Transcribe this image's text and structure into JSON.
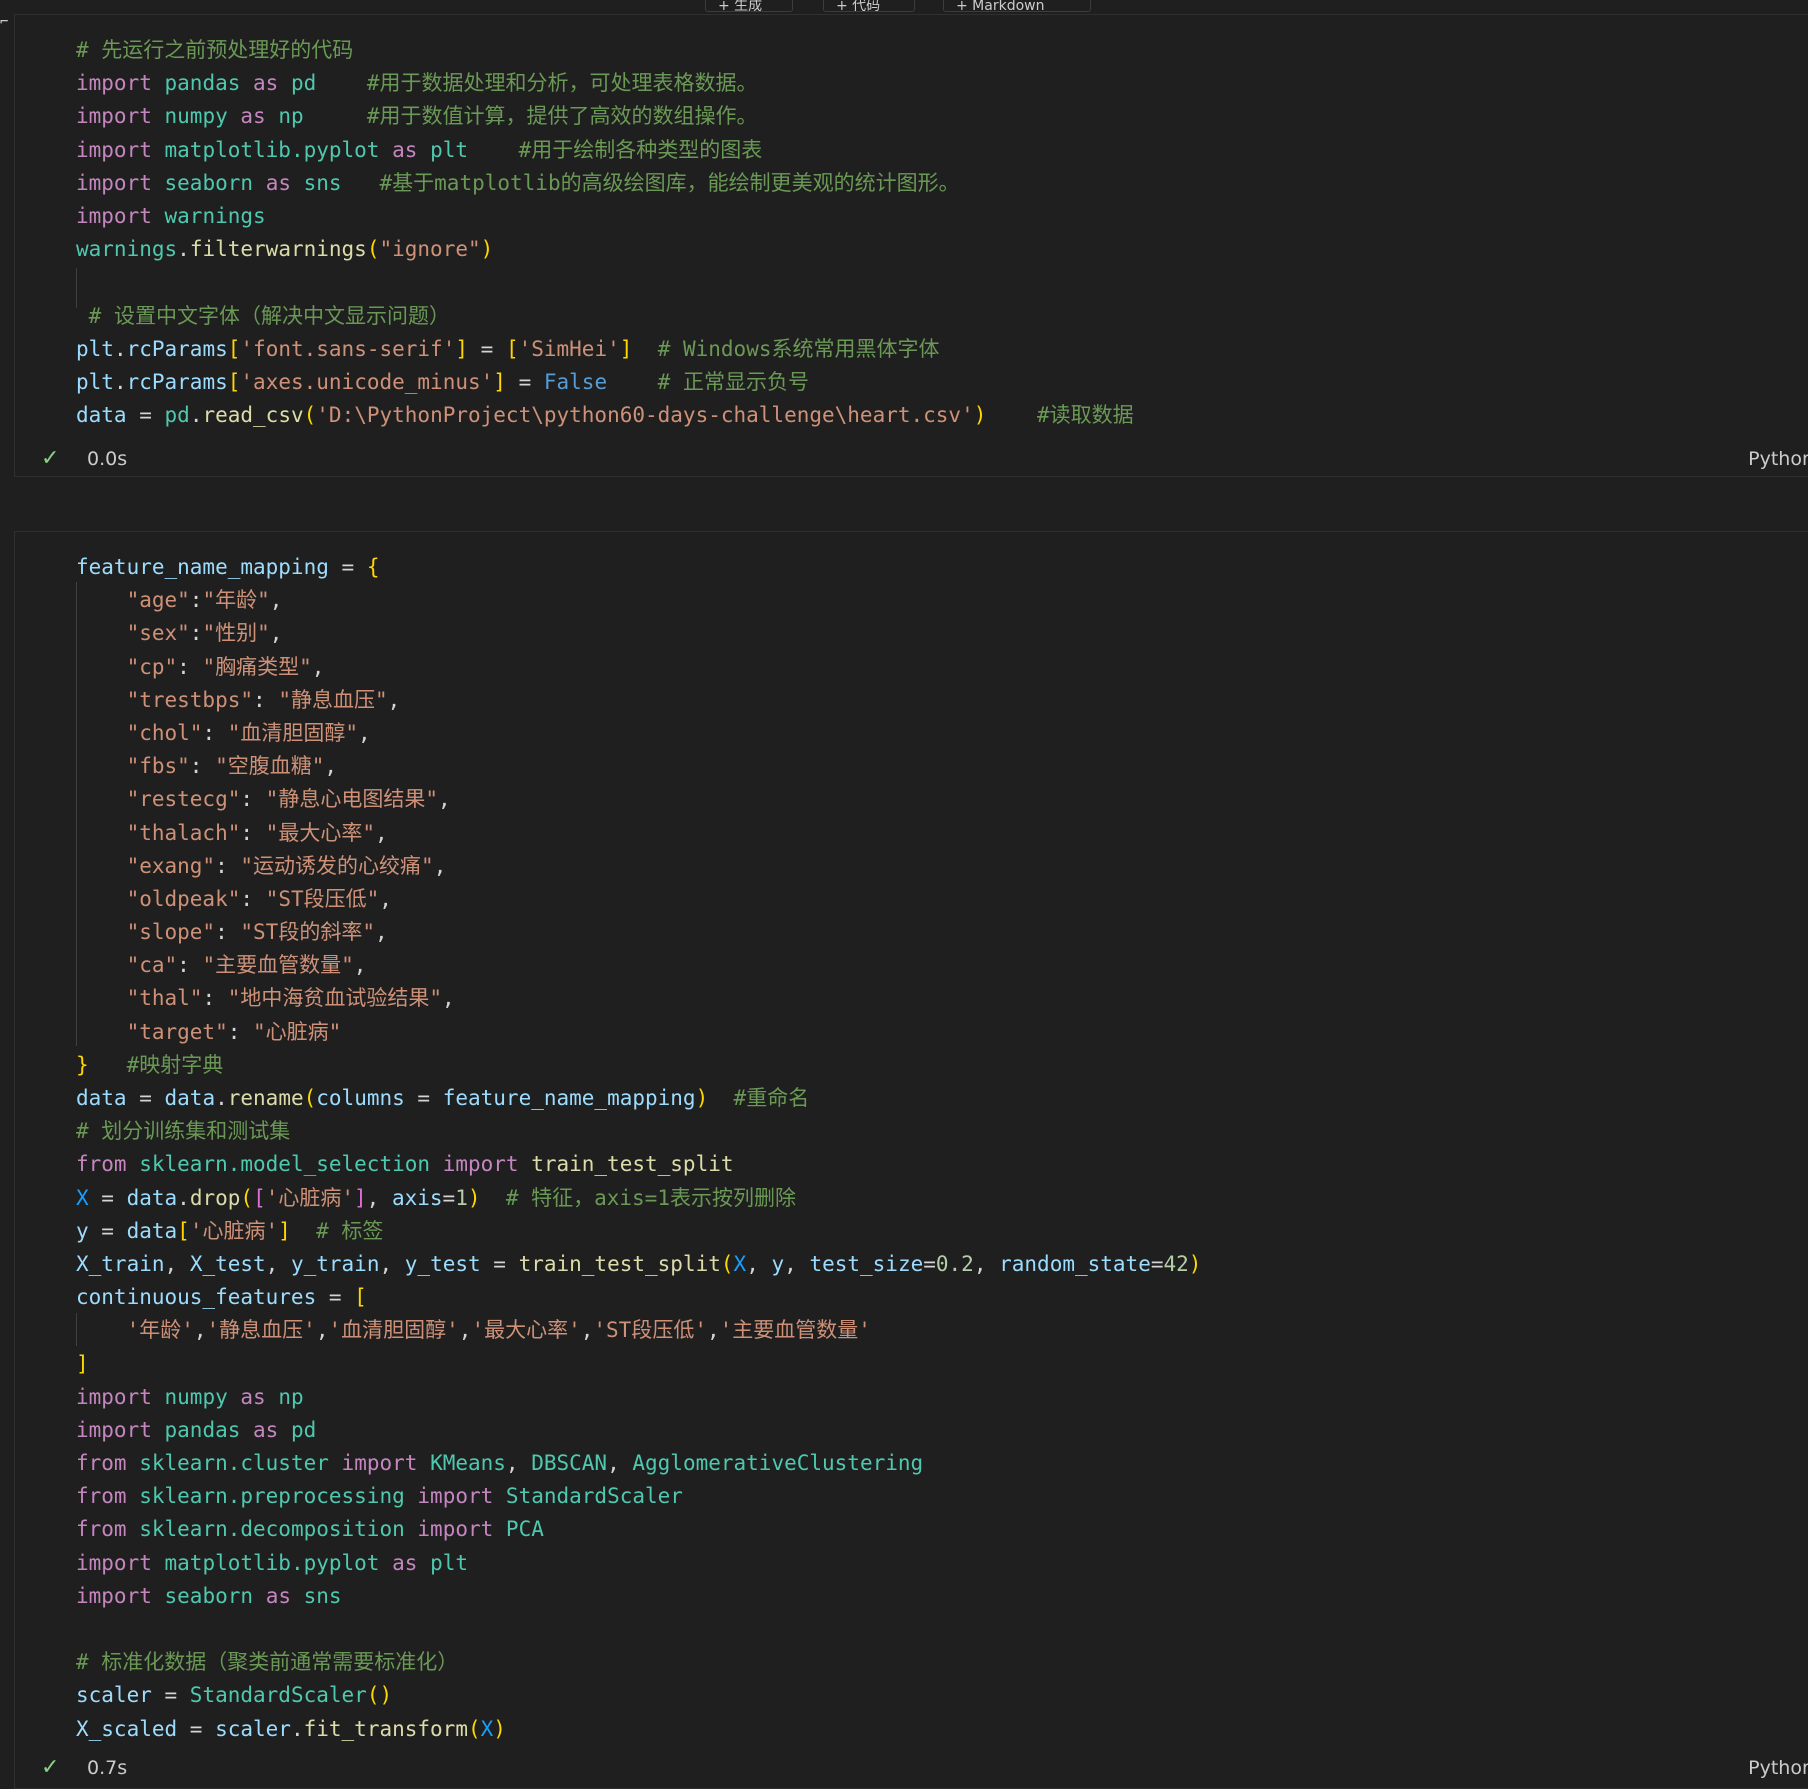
{
  "toolbar": {
    "items": [
      "+ 生成",
      "+ 代码",
      "+ Markdown"
    ]
  },
  "cell1": {
    "lines": [
      [
        [
          "c",
          "# 先运行之前预处理好的代码"
        ]
      ],
      [
        [
          "k",
          "import"
        ],
        [
          "o",
          " "
        ],
        [
          "m",
          "pandas"
        ],
        [
          "o",
          " "
        ],
        [
          "k",
          "as"
        ],
        [
          "o",
          " "
        ],
        [
          "m",
          "pd"
        ],
        [
          "o",
          "    "
        ],
        [
          "c",
          "#用于数据处理和分析，可处理表格数据。"
        ]
      ],
      [
        [
          "k",
          "import"
        ],
        [
          "o",
          " "
        ],
        [
          "m",
          "numpy"
        ],
        [
          "o",
          " "
        ],
        [
          "k",
          "as"
        ],
        [
          "o",
          " "
        ],
        [
          "m",
          "np"
        ],
        [
          "o",
          "     "
        ],
        [
          "c",
          "#用于数值计算，提供了高效的数组操作。"
        ]
      ],
      [
        [
          "k",
          "import"
        ],
        [
          "o",
          " "
        ],
        [
          "m",
          "matplotlib.pyplot"
        ],
        [
          "o",
          " "
        ],
        [
          "k",
          "as"
        ],
        [
          "o",
          " "
        ],
        [
          "m",
          "plt"
        ],
        [
          "o",
          "    "
        ],
        [
          "c",
          "#用于绘制各种类型的图表"
        ]
      ],
      [
        [
          "k",
          "import"
        ],
        [
          "o",
          " "
        ],
        [
          "m",
          "seaborn"
        ],
        [
          "o",
          " "
        ],
        [
          "k",
          "as"
        ],
        [
          "o",
          " "
        ],
        [
          "m",
          "sns"
        ],
        [
          "o",
          "   "
        ],
        [
          "c",
          "#基于matplotlib的高级绘图库，能绘制更美观的统计图形。"
        ]
      ],
      [
        [
          "k",
          "import"
        ],
        [
          "o",
          " "
        ],
        [
          "m",
          "warnings"
        ]
      ],
      [
        [
          "m",
          "warnings"
        ],
        [
          "o",
          "."
        ],
        [
          "f",
          "filterwarnings"
        ],
        [
          "y",
          "("
        ],
        [
          "s",
          "\"ignore\""
        ],
        [
          "y",
          ")"
        ]
      ],
      [
        [
          "o",
          ""
        ]
      ],
      [
        [
          "o",
          " "
        ],
        [
          "c",
          "# 设置中文字体（解决中文显示问题）"
        ]
      ],
      [
        [
          "v",
          "plt"
        ],
        [
          "o",
          "."
        ],
        [
          "v",
          "rcParams"
        ],
        [
          "y",
          "["
        ],
        [
          "s",
          "'font.sans-serif'"
        ],
        [
          "y",
          "]"
        ],
        [
          "o",
          " = "
        ],
        [
          "y",
          "["
        ],
        [
          "s",
          "'SimHei'"
        ],
        [
          "y",
          "]"
        ],
        [
          "o",
          "  "
        ],
        [
          "c",
          "# Windows系统常用黑体字体"
        ]
      ],
      [
        [
          "v",
          "plt"
        ],
        [
          "o",
          "."
        ],
        [
          "v",
          "rcParams"
        ],
        [
          "y",
          "["
        ],
        [
          "s",
          "'axes.unicode_minus'"
        ],
        [
          "y",
          "]"
        ],
        [
          "o",
          " = "
        ],
        [
          "b",
          "False"
        ],
        [
          "o",
          "    "
        ],
        [
          "c",
          "# 正常显示负号"
        ]
      ],
      [
        [
          "v",
          "data"
        ],
        [
          "o",
          " = "
        ],
        [
          "m",
          "pd"
        ],
        [
          "o",
          "."
        ],
        [
          "f",
          "read_csv"
        ],
        [
          "y",
          "("
        ],
        [
          "s",
          "'D:\\PythonProject\\python60-days-challenge\\heart.csv'"
        ],
        [
          "y",
          ")"
        ],
        [
          "o",
          "    "
        ],
        [
          "c",
          "#读取数据"
        ]
      ]
    ],
    "status_time": "0.0s",
    "language": "Python"
  },
  "cell2": {
    "lines": [
      [
        [
          "v",
          "feature_name_mapping"
        ],
        [
          "o",
          " = "
        ],
        [
          "y",
          "{"
        ]
      ],
      [
        [
          "o",
          "    "
        ],
        [
          "s",
          "\"age\""
        ],
        [
          "o",
          ":"
        ],
        [
          "s",
          "\"年龄\""
        ],
        [
          "o",
          ","
        ]
      ],
      [
        [
          "o",
          "    "
        ],
        [
          "s",
          "\"sex\""
        ],
        [
          "o",
          ":"
        ],
        [
          "s",
          "\"性别\""
        ],
        [
          "o",
          ","
        ]
      ],
      [
        [
          "o",
          "    "
        ],
        [
          "s",
          "\"cp\""
        ],
        [
          "o",
          ": "
        ],
        [
          "s",
          "\"胸痛类型\""
        ],
        [
          "o",
          ","
        ]
      ],
      [
        [
          "o",
          "    "
        ],
        [
          "s",
          "\"trestbps\""
        ],
        [
          "o",
          ": "
        ],
        [
          "s",
          "\"静息血压\""
        ],
        [
          "o",
          ","
        ]
      ],
      [
        [
          "o",
          "    "
        ],
        [
          "s",
          "\"chol\""
        ],
        [
          "o",
          ": "
        ],
        [
          "s",
          "\"血清胆固醇\""
        ],
        [
          "o",
          ","
        ]
      ],
      [
        [
          "o",
          "    "
        ],
        [
          "s",
          "\"fbs\""
        ],
        [
          "o",
          ": "
        ],
        [
          "s",
          "\"空腹血糖\""
        ],
        [
          "o",
          ","
        ]
      ],
      [
        [
          "o",
          "    "
        ],
        [
          "s",
          "\"restecg\""
        ],
        [
          "o",
          ": "
        ],
        [
          "s",
          "\"静息心电图结果\""
        ],
        [
          "o",
          ","
        ]
      ],
      [
        [
          "o",
          "    "
        ],
        [
          "s",
          "\"thalach\""
        ],
        [
          "o",
          ": "
        ],
        [
          "s",
          "\"最大心率\""
        ],
        [
          "o",
          ","
        ]
      ],
      [
        [
          "o",
          "    "
        ],
        [
          "s",
          "\"exang\""
        ],
        [
          "o",
          ": "
        ],
        [
          "s",
          "\"运动诱发的心绞痛\""
        ],
        [
          "o",
          ","
        ]
      ],
      [
        [
          "o",
          "    "
        ],
        [
          "s",
          "\"oldpeak\""
        ],
        [
          "o",
          ": "
        ],
        [
          "s",
          "\"ST段压低\""
        ],
        [
          "o",
          ","
        ]
      ],
      [
        [
          "o",
          "    "
        ],
        [
          "s",
          "\"slope\""
        ],
        [
          "o",
          ": "
        ],
        [
          "s",
          "\"ST段的斜率\""
        ],
        [
          "o",
          ","
        ]
      ],
      [
        [
          "o",
          "    "
        ],
        [
          "s",
          "\"ca\""
        ],
        [
          "o",
          ": "
        ],
        [
          "s",
          "\"主要血管数量\""
        ],
        [
          "o",
          ","
        ]
      ],
      [
        [
          "o",
          "    "
        ],
        [
          "s",
          "\"thal\""
        ],
        [
          "o",
          ": "
        ],
        [
          "s",
          "\"地中海贫血试验结果\""
        ],
        [
          "o",
          ","
        ]
      ],
      [
        [
          "o",
          "    "
        ],
        [
          "s",
          "\"target\""
        ],
        [
          "o",
          ": "
        ],
        [
          "s",
          "\"心脏病\""
        ]
      ],
      [
        [
          "y",
          "}"
        ],
        [
          "o",
          "   "
        ],
        [
          "c",
          "#映射字典"
        ]
      ],
      [
        [
          "v",
          "data"
        ],
        [
          "o",
          " = "
        ],
        [
          "v",
          "data"
        ],
        [
          "o",
          "."
        ],
        [
          "f",
          "rename"
        ],
        [
          "y",
          "("
        ],
        [
          "v",
          "columns"
        ],
        [
          "o",
          " = "
        ],
        [
          "v",
          "feature_name_mapping"
        ],
        [
          "y",
          ")"
        ],
        [
          "o",
          "  "
        ],
        [
          "c",
          "#重命名"
        ]
      ],
      [
        [
          "c",
          "# 划分训练集和测试集"
        ]
      ],
      [
        [
          "k",
          "from"
        ],
        [
          "o",
          " "
        ],
        [
          "m",
          "sklearn.model_selection"
        ],
        [
          "o",
          " "
        ],
        [
          "k",
          "import"
        ],
        [
          "o",
          " "
        ],
        [
          "f",
          "train_test_split"
        ]
      ],
      [
        [
          "bl",
          "X"
        ],
        [
          "o",
          " = "
        ],
        [
          "v",
          "data"
        ],
        [
          "o",
          "."
        ],
        [
          "f",
          "drop"
        ],
        [
          "y",
          "("
        ],
        [
          "p",
          "["
        ],
        [
          "s",
          "'心脏病'"
        ],
        [
          "p",
          "]"
        ],
        [
          "o",
          ", "
        ],
        [
          "v",
          "axis"
        ],
        [
          "o",
          "="
        ],
        [
          "n",
          "1"
        ],
        [
          "y",
          ")"
        ],
        [
          "o",
          "  "
        ],
        [
          "c",
          "# 特征，axis=1表示按列删除"
        ]
      ],
      [
        [
          "v",
          "y"
        ],
        [
          "o",
          " = "
        ],
        [
          "v",
          "data"
        ],
        [
          "y",
          "["
        ],
        [
          "s",
          "'心脏病'"
        ],
        [
          "y",
          "]"
        ],
        [
          "o",
          "  "
        ],
        [
          "c",
          "# 标签"
        ]
      ],
      [
        [
          "v",
          "X_train"
        ],
        [
          "o",
          ", "
        ],
        [
          "v",
          "X_test"
        ],
        [
          "o",
          ", "
        ],
        [
          "v",
          "y_train"
        ],
        [
          "o",
          ", "
        ],
        [
          "v",
          "y_test"
        ],
        [
          "o",
          " = "
        ],
        [
          "f",
          "train_test_split"
        ],
        [
          "y",
          "("
        ],
        [
          "bl",
          "X"
        ],
        [
          "o",
          ", "
        ],
        [
          "v",
          "y"
        ],
        [
          "o",
          ", "
        ],
        [
          "v",
          "test_size"
        ],
        [
          "o",
          "="
        ],
        [
          "n",
          "0.2"
        ],
        [
          "o",
          ", "
        ],
        [
          "v",
          "random_state"
        ],
        [
          "o",
          "="
        ],
        [
          "n",
          "42"
        ],
        [
          "y",
          ")"
        ]
      ],
      [
        [
          "v",
          "continuous_features"
        ],
        [
          "o",
          " = "
        ],
        [
          "y",
          "["
        ]
      ],
      [
        [
          "o",
          "    "
        ],
        [
          "s",
          "'年龄'"
        ],
        [
          "o",
          ","
        ],
        [
          "s",
          "'静息血压'"
        ],
        [
          "o",
          ","
        ],
        [
          "s",
          "'血清胆固醇'"
        ],
        [
          "o",
          ","
        ],
        [
          "s",
          "'最大心率'"
        ],
        [
          "o",
          ","
        ],
        [
          "s",
          "'ST段压低'"
        ],
        [
          "o",
          ","
        ],
        [
          "s",
          "'主要血管数量'"
        ]
      ],
      [
        [
          "y",
          "]"
        ]
      ],
      [
        [
          "k",
          "import"
        ],
        [
          "o",
          " "
        ],
        [
          "m",
          "numpy"
        ],
        [
          "o",
          " "
        ],
        [
          "k",
          "as"
        ],
        [
          "o",
          " "
        ],
        [
          "m",
          "np"
        ]
      ],
      [
        [
          "k",
          "import"
        ],
        [
          "o",
          " "
        ],
        [
          "m",
          "pandas"
        ],
        [
          "o",
          " "
        ],
        [
          "k",
          "as"
        ],
        [
          "o",
          " "
        ],
        [
          "m",
          "pd"
        ]
      ],
      [
        [
          "k",
          "from"
        ],
        [
          "o",
          " "
        ],
        [
          "m",
          "sklearn.cluster"
        ],
        [
          "o",
          " "
        ],
        [
          "k",
          "import"
        ],
        [
          "o",
          " "
        ],
        [
          "m",
          "KMeans"
        ],
        [
          "o",
          ", "
        ],
        [
          "m",
          "DBSCAN"
        ],
        [
          "o",
          ", "
        ],
        [
          "m",
          "AgglomerativeClustering"
        ]
      ],
      [
        [
          "k",
          "from"
        ],
        [
          "o",
          " "
        ],
        [
          "m",
          "sklearn.preprocessing"
        ],
        [
          "o",
          " "
        ],
        [
          "k",
          "import"
        ],
        [
          "o",
          " "
        ],
        [
          "m",
          "StandardScaler"
        ]
      ],
      [
        [
          "k",
          "from"
        ],
        [
          "o",
          " "
        ],
        [
          "m",
          "sklearn.decomposition"
        ],
        [
          "o",
          " "
        ],
        [
          "k",
          "import"
        ],
        [
          "o",
          " "
        ],
        [
          "m",
          "PCA"
        ]
      ],
      [
        [
          "k",
          "import"
        ],
        [
          "o",
          " "
        ],
        [
          "m",
          "matplotlib.pyplot"
        ],
        [
          "o",
          " "
        ],
        [
          "k",
          "as"
        ],
        [
          "o",
          " "
        ],
        [
          "m",
          "plt"
        ]
      ],
      [
        [
          "k",
          "import"
        ],
        [
          "o",
          " "
        ],
        [
          "m",
          "seaborn"
        ],
        [
          "o",
          " "
        ],
        [
          "k",
          "as"
        ],
        [
          "o",
          " "
        ],
        [
          "m",
          "sns"
        ]
      ],
      [
        [
          "o",
          ""
        ]
      ],
      [
        [
          "c",
          "# 标准化数据（聚类前通常需要标准化）"
        ]
      ],
      [
        [
          "v",
          "scaler"
        ],
        [
          "o",
          " = "
        ],
        [
          "m",
          "StandardScaler"
        ],
        [
          "y",
          "("
        ],
        [
          "y",
          ")"
        ]
      ],
      [
        [
          "v",
          "X_scaled"
        ],
        [
          "o",
          " = "
        ],
        [
          "v",
          "scaler"
        ],
        [
          "o",
          "."
        ],
        [
          "f",
          "fit_transform"
        ],
        [
          "y",
          "("
        ],
        [
          "bl",
          "X"
        ],
        [
          "y",
          ")"
        ]
      ]
    ],
    "status_time": "0.7s",
    "language": "Python"
  }
}
